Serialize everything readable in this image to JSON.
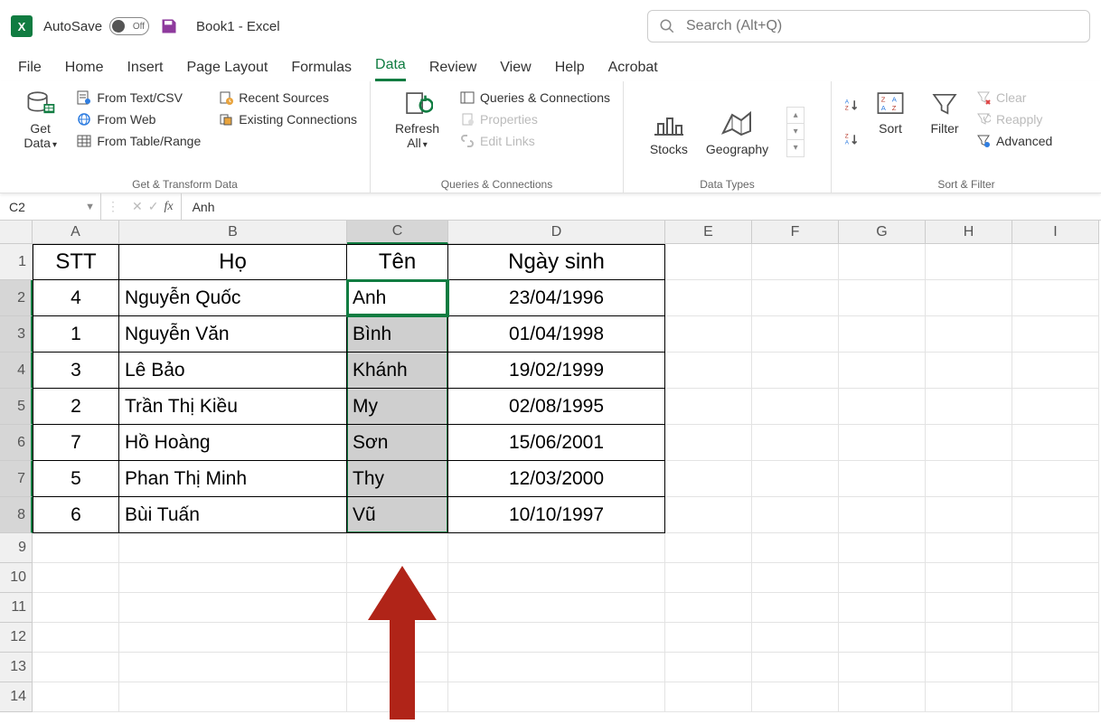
{
  "title_bar": {
    "autosave_label": "AutoSave",
    "toggle_text": "Off",
    "doc_title": "Book1  -  Excel",
    "search_placeholder": "Search (Alt+Q)"
  },
  "menu": {
    "tabs": [
      "File",
      "Home",
      "Insert",
      "Page Layout",
      "Formulas",
      "Data",
      "Review",
      "View",
      "Help",
      "Acrobat"
    ],
    "active": "Data"
  },
  "ribbon": {
    "get_transform": {
      "get_data": "Get Data",
      "from_text": "From Text/CSV",
      "from_web": "From Web",
      "from_table": "From Table/Range",
      "recent": "Recent Sources",
      "existing": "Existing Connections",
      "label": "Get & Transform Data"
    },
    "queries": {
      "refresh": "Refresh All",
      "qc": "Queries & Connections",
      "props": "Properties",
      "edit_links": "Edit Links",
      "label": "Queries & Connections"
    },
    "data_types": {
      "stocks": "Stocks",
      "geography": "Geography",
      "label": "Data Types"
    },
    "sort_filter": {
      "sort": "Sort",
      "filter": "Filter",
      "clear": "Clear",
      "reapply": "Reapply",
      "advanced": "Advanced",
      "label": "Sort & Filter"
    }
  },
  "formula_bar": {
    "name_box": "C2",
    "formula": "Anh"
  },
  "columns": [
    "A",
    "B",
    "C",
    "D",
    "E",
    "F",
    "G",
    "H",
    "I"
  ],
  "rows_visible": 14,
  "table": {
    "headers": {
      "stt": "STT",
      "ho": "Họ",
      "ten": "Tên",
      "ngaysinh": "Ngày sinh"
    },
    "rows": [
      {
        "stt": "4",
        "ho": "Nguyễn Quốc",
        "ten": "Anh",
        "ns": "23/04/1996"
      },
      {
        "stt": "1",
        "ho": "Nguyễn Văn",
        "ten": "Bình",
        "ns": "01/04/1998"
      },
      {
        "stt": "3",
        "ho": "Lê Bảo",
        "ten": "Khánh",
        "ns": "19/02/1999"
      },
      {
        "stt": "2",
        "ho": "Trần Thị Kiều",
        "ten": "My",
        "ns": "02/08/1995"
      },
      {
        "stt": "7",
        "ho": "Hồ Hoàng",
        "ten": "Sơn",
        "ns": "15/06/2001"
      },
      {
        "stt": "5",
        "ho": "Phan Thị Minh",
        "ten": "Thy",
        "ns": "12/03/2000"
      },
      {
        "stt": "6",
        "ho": "Bùi Tuấn",
        "ten": "Vũ",
        "ns": "10/10/1997"
      }
    ]
  }
}
